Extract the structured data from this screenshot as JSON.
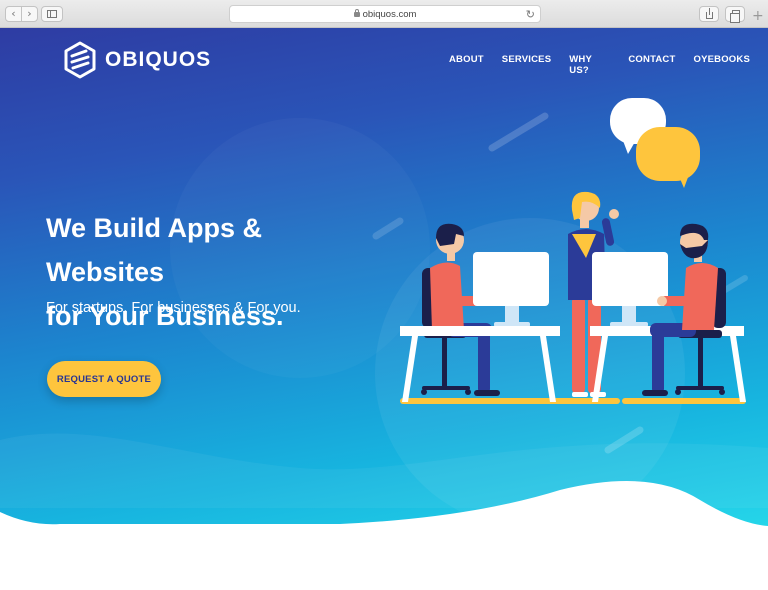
{
  "browser": {
    "back_glyph": "‹",
    "forward_glyph": "›",
    "url": "obiquos.com",
    "reload_glyph": "↻",
    "new_tab_glyph": "+"
  },
  "brand": {
    "name": "OBIQUOS",
    "logo_icon": "hexagon-logo-icon"
  },
  "nav": {
    "items": [
      {
        "label": "ABOUT"
      },
      {
        "label": "SERVICES"
      },
      {
        "label": "WHY US?"
      },
      {
        "label": "CONTACT"
      },
      {
        "label": "OYEBOOKS"
      }
    ]
  },
  "hero": {
    "headline_line1": "We Build Apps & Websites",
    "headline_line2": "for Your Business.",
    "subheadline": "For startups, For businesses & For you.",
    "cta_label": "REQUEST A QUOTE"
  },
  "colors": {
    "gradient_top": "#2e3ca3",
    "gradient_bottom": "#2ce6ee",
    "cta": "#fec53d",
    "cta_text": "#283593",
    "shirt": "#f0685a",
    "pants": "#2b3b98",
    "speech_bubble_yellow": "#fec53d"
  }
}
